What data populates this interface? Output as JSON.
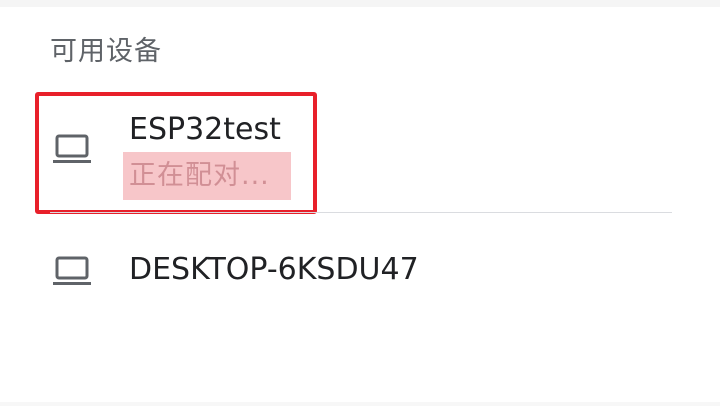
{
  "section": {
    "title": "可用设备"
  },
  "devices": [
    {
      "name": "ESP32test",
      "status": "正在配对...",
      "icon": "laptop-icon"
    },
    {
      "name": "DESKTOP-6KSDU47",
      "icon": "laptop-icon"
    }
  ],
  "colors": {
    "highlight_border": "#e8202a",
    "status_highlight_bg": "#f7c6c9",
    "status_text": "#d18f95",
    "primary_text": "#202124",
    "secondary_text": "#5f6368",
    "divider": "#dadce0"
  }
}
